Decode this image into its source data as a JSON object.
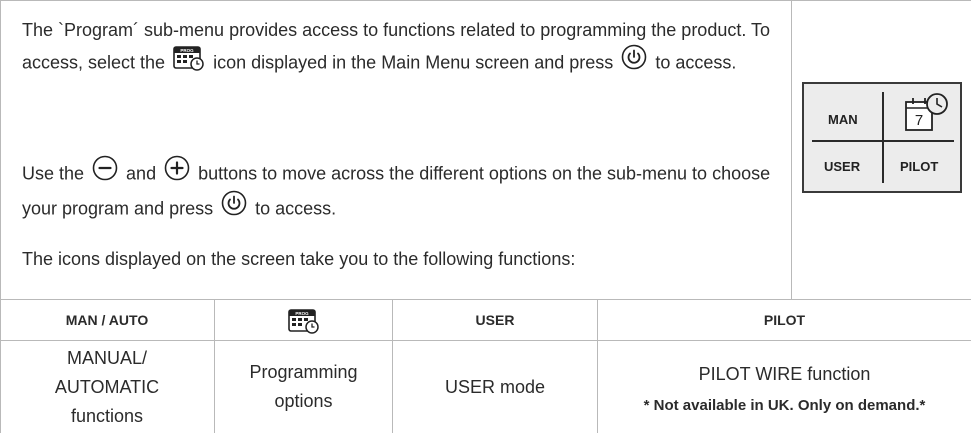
{
  "intro": {
    "p1_before_icon": "The `Program´ sub-menu provides access to functions related to programming the product. To access, select the ",
    "p1_after_icon": " icon displayed in the Main Menu screen and press ",
    "p1_end": " to access.",
    "p2_start": "Use the ",
    "p2_and": " and ",
    "p2_middle": " buttons to move across the different options on the sub-menu to choose your program and press ",
    "p2_end": " to access.",
    "p3": "The icons displayed on the screen take you to the following functions:"
  },
  "icons": {
    "program": "prog-calendar-icon",
    "power": "power-icon",
    "minus": "minus-icon",
    "plus": "plus-icon",
    "program_badge": "PROG",
    "clock_calendar": "calendar-clock-icon",
    "calendar_day": "7"
  },
  "panel": {
    "top_left": "MAN",
    "bottom_left": "USER",
    "bottom_right": "PILOT"
  },
  "table": {
    "headers": [
      "MAN / AUTO",
      "",
      "USER",
      "PILOT"
    ],
    "cells": {
      "man_auto": "MANUAL/ AUTOMATIC functions",
      "program": "Programming options",
      "user": "USER mode",
      "pilot": "PILOT WIRE function",
      "pilot_note": "* Not available in UK. Only on demand.*"
    }
  }
}
